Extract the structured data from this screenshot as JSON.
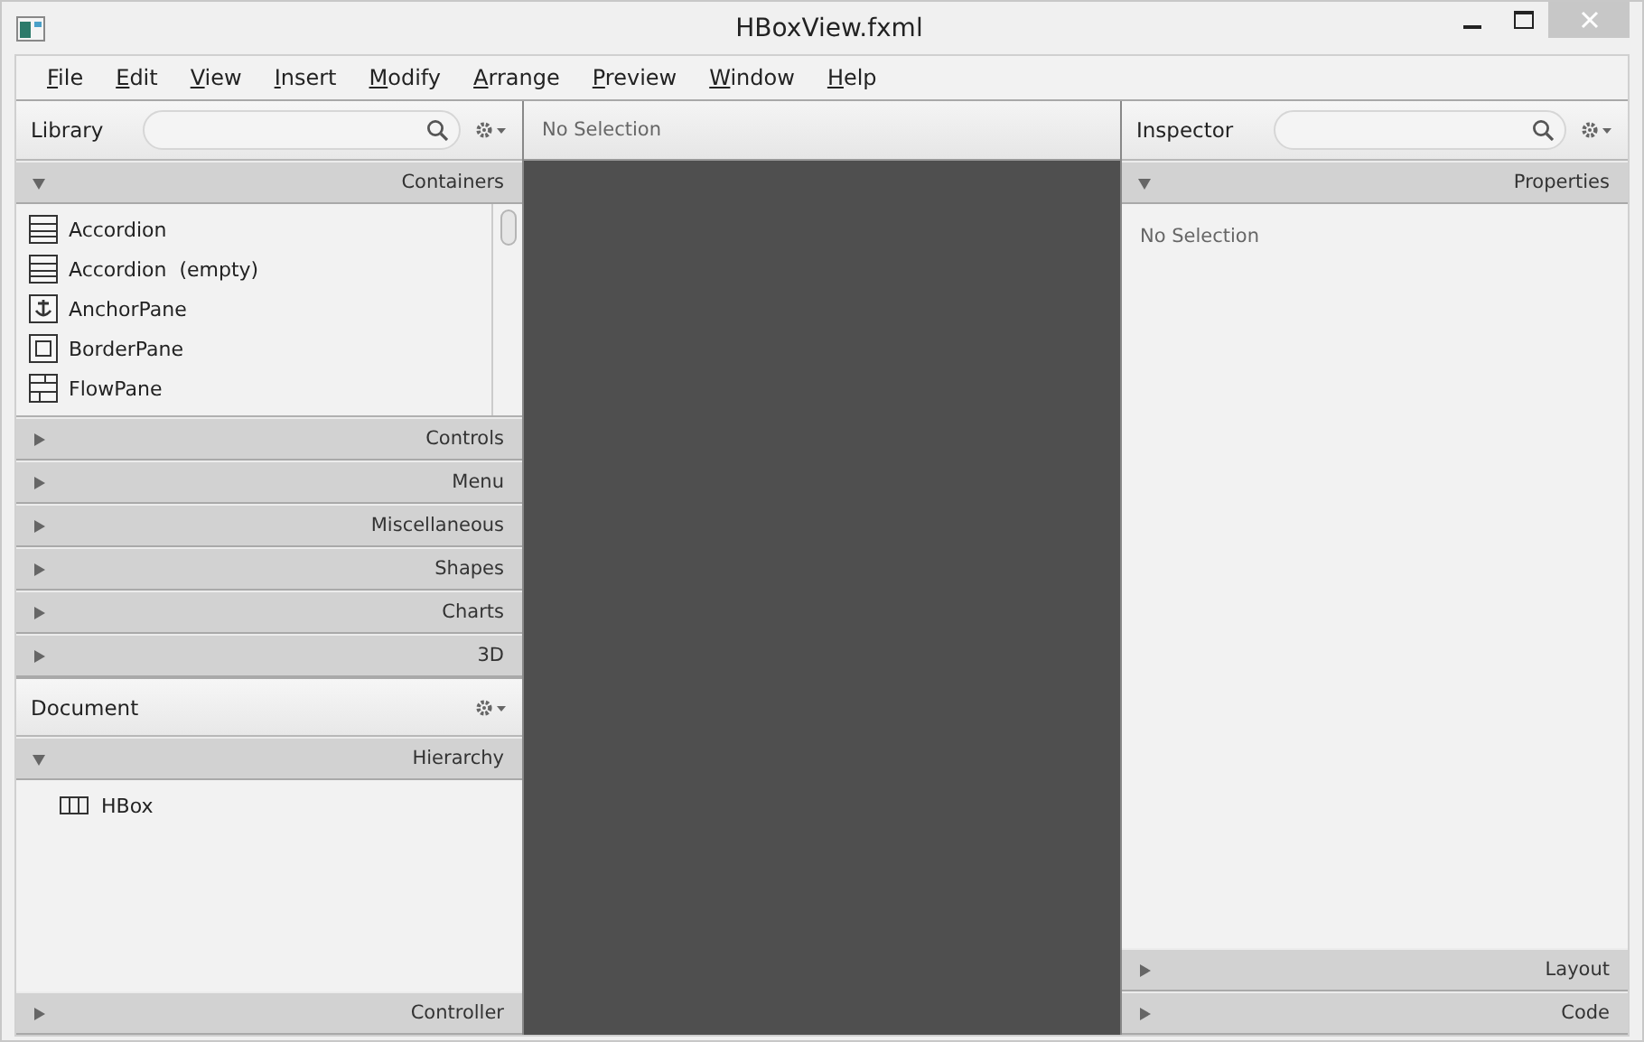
{
  "window": {
    "title": "HBoxView.fxml"
  },
  "menu": [
    "File",
    "Edit",
    "View",
    "Insert",
    "Modify",
    "Arrange",
    "Preview",
    "Window",
    "Help"
  ],
  "library": {
    "title": "Library",
    "sections": [
      {
        "label": "Containers",
        "expanded": true,
        "items": [
          {
            "label": "Accordion",
            "kind": "accordion"
          },
          {
            "label": "Accordion  (empty)",
            "kind": "accordion"
          },
          {
            "label": "AnchorPane",
            "kind": "anchor"
          },
          {
            "label": "BorderPane",
            "kind": "border"
          },
          {
            "label": "FlowPane",
            "kind": "flow"
          }
        ]
      },
      {
        "label": "Controls",
        "expanded": false
      },
      {
        "label": "Menu",
        "expanded": false
      },
      {
        "label": "Miscellaneous",
        "expanded": false
      },
      {
        "label": "Shapes",
        "expanded": false
      },
      {
        "label": "Charts",
        "expanded": false
      },
      {
        "label": "3D",
        "expanded": false
      }
    ]
  },
  "document": {
    "title": "Document",
    "sections": [
      {
        "label": "Hierarchy",
        "expanded": true,
        "tree": [
          {
            "label": "HBox"
          }
        ]
      },
      {
        "label": "Controller",
        "expanded": false
      }
    ]
  },
  "content": {
    "header": "No Selection"
  },
  "inspector": {
    "title": "Inspector",
    "sections": [
      {
        "label": "Properties",
        "expanded": true,
        "message": "No Selection"
      },
      {
        "label": "Layout",
        "expanded": false
      },
      {
        "label": "Code",
        "expanded": false
      }
    ]
  }
}
